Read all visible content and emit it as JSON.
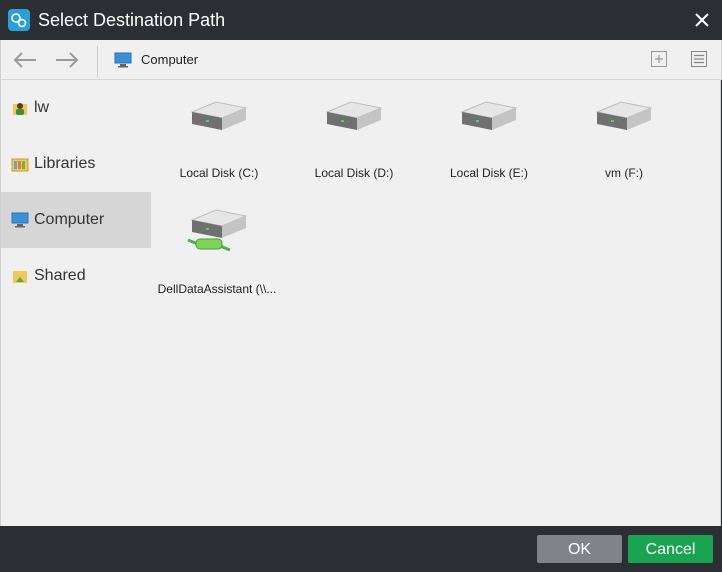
{
  "window": {
    "title": "Select Destination Path"
  },
  "toolbar": {
    "breadcrumb": "Computer"
  },
  "sidebar": {
    "items": [
      {
        "label": "lw",
        "icon": "user-folder-icon"
      },
      {
        "label": "Libraries",
        "icon": "libraries-icon"
      },
      {
        "label": "Computer",
        "icon": "computer-icon",
        "selected": true
      },
      {
        "label": "Shared",
        "icon": "shared-folder-icon"
      }
    ]
  },
  "drives": [
    {
      "label": "Local Disk (C:)",
      "icon": "hard-drive-icon"
    },
    {
      "label": "Local Disk (D:)",
      "icon": "hard-drive-icon"
    },
    {
      "label": "Local Disk (E:)",
      "icon": "hard-drive-icon"
    },
    {
      "label": "vm (F:)",
      "icon": "hard-drive-icon"
    },
    {
      "label": "DellDataAssistant (\\\\...",
      "icon": "network-drive-icon"
    }
  ],
  "footer": {
    "ok_label": "OK",
    "cancel_label": "Cancel"
  },
  "colors": {
    "titlebar": "#2b2e33",
    "ok": "#808488",
    "cancel": "#1aa350",
    "selected": "#d6d6d6"
  }
}
